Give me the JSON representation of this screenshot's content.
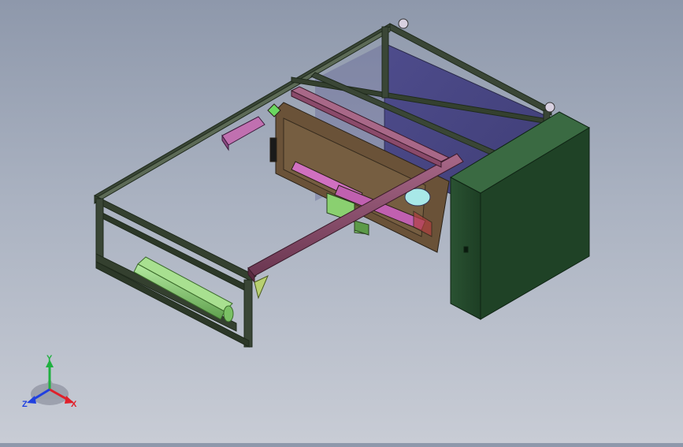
{
  "viewport": {
    "description_colors": {
      "frame": "#2e3b2c",
      "beam": "#8a4a6a",
      "panel": "#4a4a82",
      "cabinet": "#244a2c",
      "roller": "#8ed07a"
    }
  },
  "triad": {
    "x_label": "X",
    "y_label": "Y",
    "z_label": "Z",
    "x_color": "#e0202a",
    "y_color": "#20b040",
    "z_color": "#2040e0"
  }
}
